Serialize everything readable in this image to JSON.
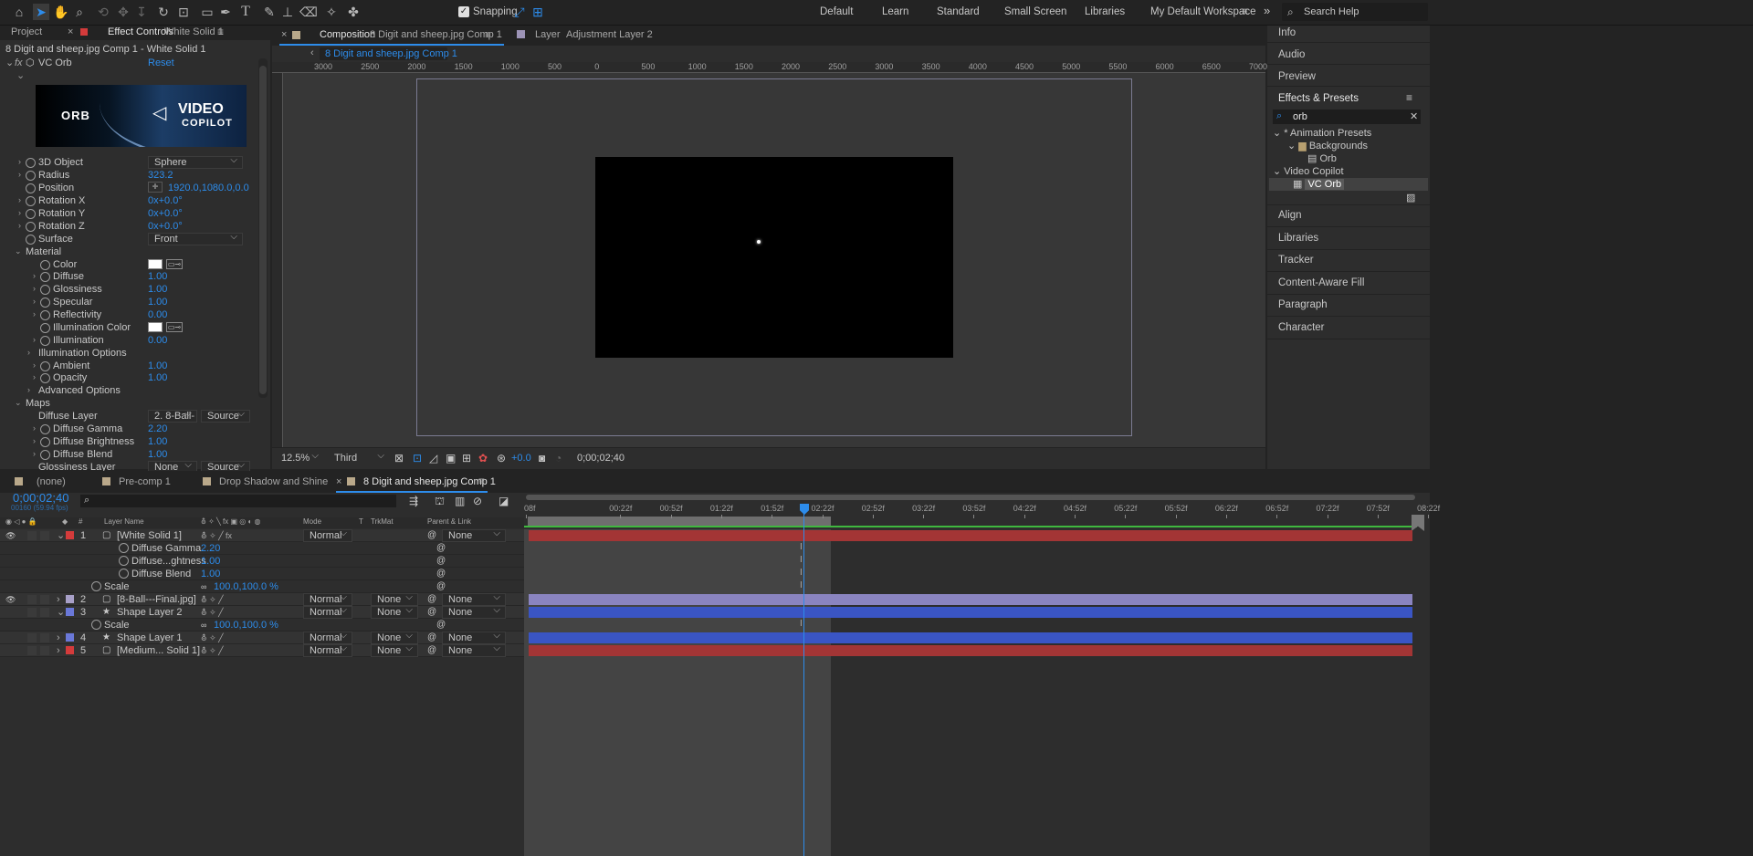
{
  "toolbar": {
    "snapping": "Snapping",
    "workspaces": [
      "Default",
      "Learn",
      "Standard",
      "Small Screen",
      "Libraries",
      "My Default Workspace"
    ],
    "search_placeholder": "Search Help"
  },
  "left_tabs": {
    "project": "Project",
    "effect_controls": "Effect Controls",
    "effect_layer": "White Solid 1"
  },
  "effect_header": {
    "comp_path": "8 Digit and sheep.jpg Comp 1 - White Solid 1",
    "effect_name": "VC Orb",
    "reset": "Reset",
    "banner_left": "ORB",
    "banner_brand": "VIDEO",
    "banner_brand2": "COPILOT"
  },
  "props": [
    {
      "label": "3D Object",
      "value": "Sphere"
    },
    {
      "label": "Radius",
      "value": "323.2"
    },
    {
      "label": "Position",
      "value": "1920.0,1080.0,0.0"
    },
    {
      "label": "Rotation X",
      "value": "0x+0.0°"
    },
    {
      "label": "Rotation Y",
      "value": "0x+0.0°"
    },
    {
      "label": "Rotation Z",
      "value": "0x+0.0°"
    },
    {
      "label": "Surface",
      "value": "Front"
    },
    {
      "label": "Material"
    },
    {
      "label": "Color"
    },
    {
      "label": "Diffuse",
      "value": "1.00"
    },
    {
      "label": "Glossiness",
      "value": "1.00"
    },
    {
      "label": "Specular",
      "value": "1.00"
    },
    {
      "label": "Reflectivity",
      "value": "0.00"
    },
    {
      "label": "Illumination Color"
    },
    {
      "label": "Illumination",
      "value": "0.00"
    },
    {
      "label": "Illumination Options"
    },
    {
      "label": "Ambient",
      "value": "1.00"
    },
    {
      "label": "Opacity",
      "value": "1.00"
    },
    {
      "label": "Advanced Options"
    },
    {
      "label": "Maps"
    },
    {
      "label": "Diffuse Layer",
      "value": "2. 8-Ball-",
      "value2": "Source"
    },
    {
      "label": "Diffuse Gamma",
      "value": "2.20"
    },
    {
      "label": "Diffuse Brightness",
      "value": "1.00"
    },
    {
      "label": "Diffuse Blend",
      "value": "1.00"
    },
    {
      "label": "Glossiness Layer",
      "value": "None",
      "value2": "Source"
    }
  ],
  "comp_tabs": {
    "composition": "Composition",
    "comp_name": "8 Digit and sheep.jpg Comp 1",
    "layer": "Layer",
    "layer_name": "Adjustment Layer 2",
    "breadcrumb": "8 Digit and sheep.jpg Comp 1"
  },
  "ruler": [
    "3000",
    "2500",
    "2000",
    "1500",
    "1000",
    "500",
    "0",
    "500",
    "1000",
    "1500",
    "2000",
    "2500",
    "3000",
    "3500",
    "4000",
    "4500",
    "5000",
    "5500",
    "6000",
    "6500",
    "7000"
  ],
  "viewer_footer": {
    "zoom": "12.5%",
    "resolution": "Third",
    "exposure": "+0.0",
    "timecode": "0;00;02;40"
  },
  "right_panel": {
    "info": "Info",
    "audio": "Audio",
    "preview": "Preview",
    "effects": "Effects & Presets",
    "search": "orb",
    "tree": [
      "* Animation Presets",
      "Backgrounds",
      "Orb",
      "Video Copilot",
      "VC Orb"
    ],
    "more": [
      "Align",
      "Libraries",
      "Tracker",
      "Content-Aware Fill",
      "Paragraph",
      "Character"
    ]
  },
  "timeline": {
    "tabs": [
      "(none)",
      "Pre-comp 1",
      "Drop Shadow and Shine",
      "8 Digit and sheep.jpg Comp 1"
    ],
    "timecode": "0;00;02;40",
    "fps": "00160 (59.94 fps)",
    "headers": {
      "layer_name": "Layer Name",
      "mode": "Mode",
      "t": "T",
      "trkmat": "TrkMat",
      "parent": "Parent & Link"
    },
    "ruler": [
      "08f",
      "00:22f",
      "00:52f",
      "01:22f",
      "01:52f",
      "02:22f",
      "02:52f",
      "03:22f",
      "03:52f",
      "04:22f",
      "04:52f",
      "05:22f",
      "05:52f",
      "06:22f",
      "06:52f",
      "07:22f",
      "07:52f",
      "08:22f"
    ],
    "rows": [
      {
        "num": "1",
        "name": "[White Solid 1]",
        "mode": "Normal",
        "parent": "None"
      },
      {
        "name": "Diffuse Gamma",
        "value": "2.20"
      },
      {
        "name": "Diffuse...ghtness",
        "value": "1.00"
      },
      {
        "name": "Diffuse Blend",
        "value": "1.00"
      },
      {
        "name": "Scale",
        "value": "100.0,100.0 %"
      },
      {
        "num": "2",
        "name": "[8-Ball---Final.jpg]",
        "mode": "Normal",
        "trk": "None",
        "parent": "None"
      },
      {
        "num": "3",
        "name": "Shape Layer 2",
        "mode": "Normal",
        "trk": "None",
        "parent": "None"
      },
      {
        "name": "Scale",
        "value": "100.0,100.0 %"
      },
      {
        "num": "4",
        "name": "Shape Layer 1",
        "mode": "Normal",
        "trk": "None",
        "parent": "None"
      },
      {
        "num": "5",
        "name": "[Medium... Solid 1]",
        "mode": "Normal",
        "trk": "None",
        "parent": "None"
      }
    ]
  }
}
